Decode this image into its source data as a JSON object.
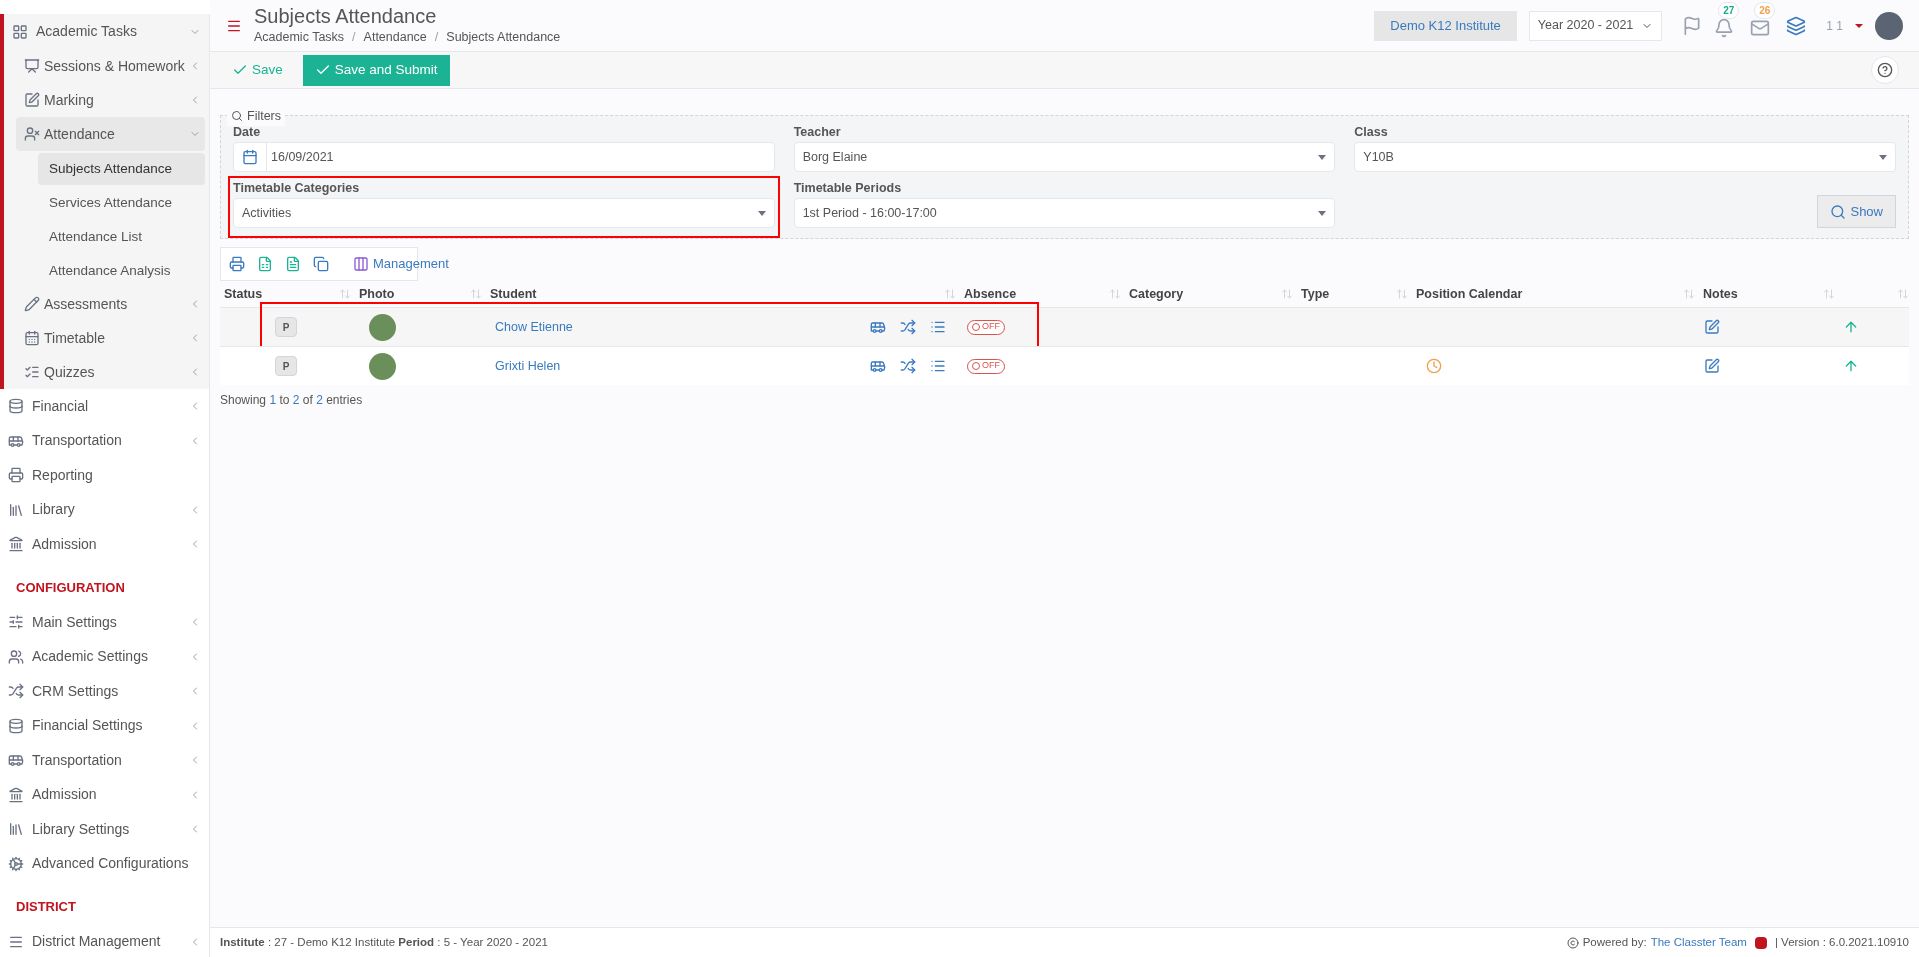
{
  "sidebar": {
    "sections": [
      {
        "items": [
          {
            "label": "Academic Tasks",
            "expanded": true,
            "children": [
              {
                "label": "Sessions & Homework",
                "expanded": false
              },
              {
                "label": "Marking",
                "expanded": false
              },
              {
                "label": "Attendance",
                "expanded": true,
                "children": [
                  {
                    "label": "Subjects Attendance",
                    "selected": true
                  },
                  {
                    "label": "Services Attendance",
                    "selected": false
                  },
                  {
                    "label": "Attendance List",
                    "selected": false
                  },
                  {
                    "label": "Attendance Analysis",
                    "selected": false
                  }
                ]
              },
              {
                "label": "Assessments",
                "expanded": false
              },
              {
                "label": "Timetable",
                "expanded": false
              },
              {
                "label": "Quizzes",
                "expanded": false
              }
            ]
          },
          {
            "label": "Financial",
            "expanded": false
          },
          {
            "label": "Transportation",
            "expanded": false
          },
          {
            "label": "Reporting"
          },
          {
            "label": "Library",
            "expanded": false
          },
          {
            "label": "Admission",
            "expanded": false
          }
        ]
      },
      {
        "heading": "CONFIGURATION",
        "items": [
          {
            "label": "Main Settings",
            "expanded": false
          },
          {
            "label": "Academic Settings",
            "expanded": false
          },
          {
            "label": "CRM Settings",
            "expanded": false
          },
          {
            "label": "Financial Settings",
            "expanded": false
          },
          {
            "label": "Transportation",
            "expanded": false
          },
          {
            "label": "Admission",
            "expanded": false
          },
          {
            "label": "Library Settings",
            "expanded": false
          },
          {
            "label": "Advanced Configurations"
          }
        ]
      },
      {
        "heading": "DISTRICT",
        "items": [
          {
            "label": "District Management",
            "expanded": false
          }
        ]
      }
    ]
  },
  "header": {
    "title": "Subjects Attendance",
    "breadcrumb": [
      "Academic Tasks",
      "Attendance",
      "Subjects Attendance"
    ],
    "breadcrumb_separator": "/",
    "institute": "Demo K12 Institute",
    "year": "Year 2020 - 2021",
    "notifications": "27",
    "messages": "26",
    "user": "1 1"
  },
  "toolbar": {
    "buttons": [
      {
        "label": "Save",
        "kind": "link"
      },
      {
        "label": "Save and Submit",
        "kind": "primary"
      }
    ]
  },
  "filters": {
    "legend": "Filters",
    "fields": [
      {
        "label": "Date",
        "kind": "date",
        "value": "16/09/2021",
        "highlighted": false
      },
      {
        "label": "Teacher",
        "kind": "select",
        "value": "Borg Elaine",
        "highlighted": false
      },
      {
        "label": "Class",
        "kind": "select",
        "value": "Y10B",
        "highlighted": false
      },
      {
        "label": "Timetable Categories",
        "kind": "select",
        "value": "Activities",
        "highlighted": true
      },
      {
        "label": "Timetable Periods",
        "kind": "select",
        "value": "1st Period - 16:00-17:00",
        "highlighted": false
      }
    ],
    "show_button": "Show"
  },
  "table": {
    "management_button": "Management",
    "columns": [
      "Status",
      "Photo",
      "Student",
      "Absence",
      "Category",
      "Type",
      "Position Calendar",
      "Notes"
    ],
    "rows": [
      {
        "status": "P",
        "student": "Chow Etienne",
        "absence": "OFF",
        "absent": false,
        "calendar_marked": false,
        "highlighted": true
      },
      {
        "status": "P",
        "student": "Grixti Helen",
        "absence": "OFF",
        "absent": false,
        "calendar_marked": true,
        "highlighted": false
      }
    ],
    "info": [
      "Showing ",
      "1",
      " to ",
      "2",
      " of ",
      "2",
      " entries"
    ]
  },
  "footer": {
    "info": "**Institute** : 27 - Demo K12 Institute **Period** : 5 - Year 2020 - 2021",
    "powered": "Powered by:",
    "team": "The Classter Team",
    "version": "| Version : 6.0.2021.10910"
  }
}
